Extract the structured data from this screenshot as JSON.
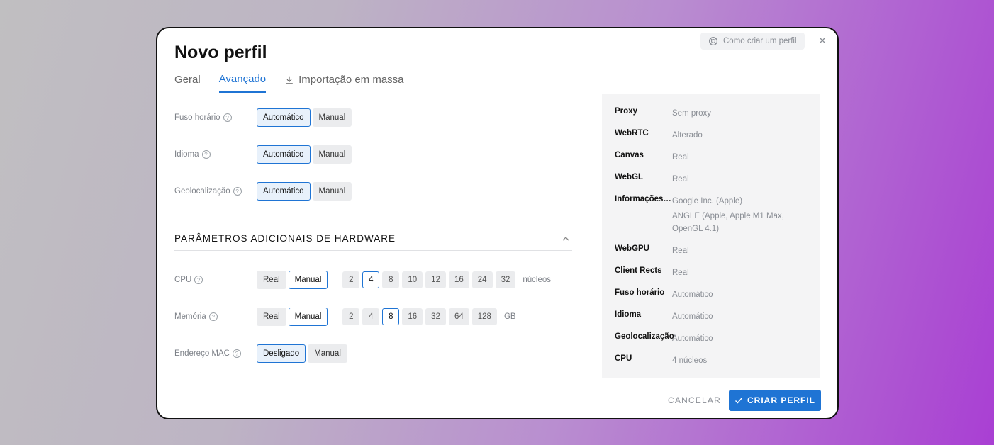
{
  "header": {
    "title": "Novo perfil",
    "help_label": "Como criar um perfil"
  },
  "tabs": [
    {
      "label": "Geral"
    },
    {
      "label": "Avançado"
    },
    {
      "label": "Importação em massa"
    }
  ],
  "settings": {
    "timezone": {
      "label": "Fuso horário",
      "options": [
        "Automático",
        "Manual"
      ],
      "selected": "Automático"
    },
    "language": {
      "label": "Idioma",
      "options": [
        "Automático",
        "Manual"
      ],
      "selected": "Automático"
    },
    "geolocation": {
      "label": "Geolocalização",
      "options": [
        "Automático",
        "Manual"
      ],
      "selected": "Automático"
    }
  },
  "hardware": {
    "section_title": "PARÂMETROS ADICIONAIS DE HARDWARE",
    "cpu": {
      "label": "CPU",
      "modes": [
        "Real",
        "Manual"
      ],
      "values": [
        "2",
        "4",
        "8",
        "10",
        "12",
        "16",
        "24",
        "32"
      ],
      "selected": "4",
      "unit": "núcleos"
    },
    "memory": {
      "label": "Memória",
      "modes": [
        "Real",
        "Manual"
      ],
      "values": [
        "2",
        "4",
        "8",
        "16",
        "32",
        "64",
        "128"
      ],
      "selected": "8",
      "unit": "GB"
    },
    "mac": {
      "label": "Endereço MAC",
      "options": [
        "Desligado",
        "Manual"
      ],
      "selected": "Desligado"
    }
  },
  "summary": [
    {
      "key": "Proxy",
      "value": "Sem proxy"
    },
    {
      "key": "WebRTC",
      "value": "Alterado"
    },
    {
      "key": "Canvas",
      "value": "Real"
    },
    {
      "key": "WebGL",
      "value": "Real"
    },
    {
      "key": "Informações ...",
      "value": "Google Inc. (Apple)",
      "value2": "ANGLE (Apple, Apple M1 Max, OpenGL 4.1)"
    },
    {
      "key": "WebGPU",
      "value": "Real"
    },
    {
      "key": "Client Rects",
      "value": "Real"
    },
    {
      "key": "Fuso horário",
      "value": "Automático"
    },
    {
      "key": "Idioma",
      "value": "Automático"
    },
    {
      "key": "Geolocalização",
      "value": "Automático"
    },
    {
      "key": "CPU",
      "value": "4 núcleos"
    }
  ],
  "footer": {
    "cancel_label": "CANCELAR",
    "create_label": "CRIAR PERFIL"
  },
  "colors": {
    "accent": "#1f74d4"
  }
}
